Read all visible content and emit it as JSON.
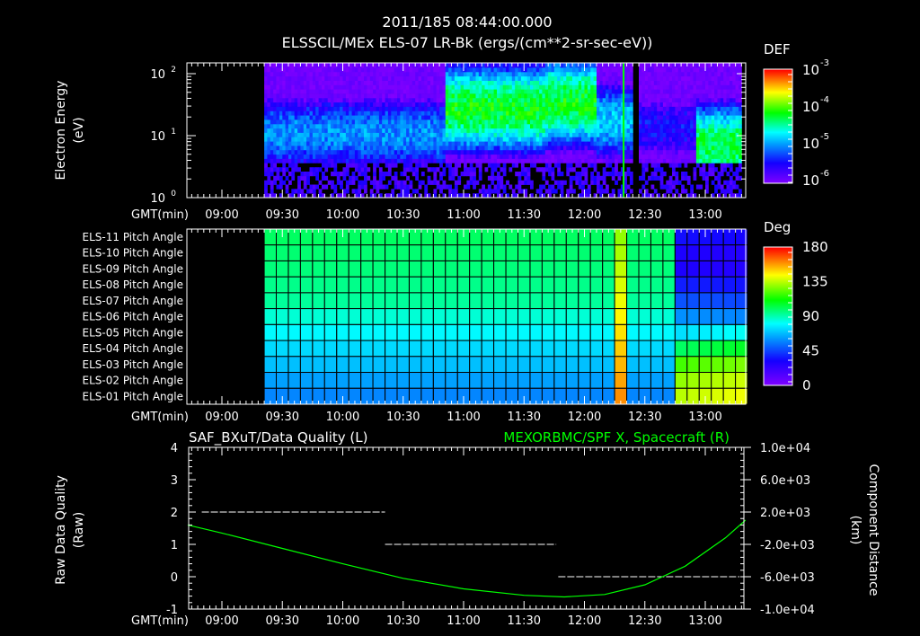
{
  "header": {
    "timestamp": "2011/185 08:44:00.000",
    "title": "ELSSCIL/MEx ELS-07 LR-Bk  (ergs/(cm**2-sr-sec-eV))"
  },
  "colors": {
    "background": "#000000",
    "axis": "#ffffff",
    "orbit_line": "#00ff00",
    "quality_line": "#ffffff"
  },
  "chart_data": [
    {
      "type": "heatmap",
      "name": "energy-spectrogram",
      "ylabel": "Electron Energy\n(eV)",
      "ylabel_lines": [
        "Electron Energy",
        "(eV)"
      ],
      "xlabel": "GMT(min)",
      "yscale": "log",
      "ylim_log10": [
        0,
        2.17
      ],
      "yticks": [
        {
          "exp": 0,
          "label": "10",
          "sup": "0"
        },
        {
          "exp": 1,
          "label": "10",
          "sup": "1"
        },
        {
          "exp": 2,
          "label": "10",
          "sup": "2"
        }
      ],
      "xlim_min": [
        522.6,
        800
      ],
      "xticks": [
        "09:00",
        "09:30",
        "10:00",
        "10:30",
        "11:00",
        "11:30",
        "12:00",
        "12:30",
        "13:00"
      ],
      "colorbar": {
        "label": "DEF",
        "scale": "log",
        "range_log10": [
          -6.3,
          -3
        ],
        "ticks": [
          {
            "base": "10",
            "sup": "-3"
          },
          {
            "base": "10",
            "sup": "-4"
          },
          {
            "base": "10",
            "sup": "-5"
          },
          {
            "base": "10",
            "sup": "-6"
          }
        ]
      },
      "segments": [
        {
          "start": "09:21",
          "end": "10:50",
          "peak_energy_log10": 1.0,
          "peak_def_log10": -5.2
        },
        {
          "start": "10:50",
          "end": "11:40",
          "peak_energy_log10": 1.4,
          "peak_def_log10": -4.3
        },
        {
          "start": "11:40",
          "end": "12:05",
          "peak_energy_log10": 1.5,
          "peak_def_log10": -4.3
        },
        {
          "start": "12:05",
          "end": "12:25",
          "peak_energy_log10": 1.2,
          "peak_def_log10": -5.0
        },
        {
          "start": "12:25",
          "end": "12:55",
          "peak_energy_log10": 1.1,
          "peak_def_log10": -5.7
        },
        {
          "start": "12:55",
          "end": "13:18",
          "peak_energy_log10": 0.8,
          "peak_def_log10": -4.4
        }
      ],
      "data_gaps": [
        {
          "start": "12:24",
          "end": "12:27"
        }
      ]
    },
    {
      "type": "heatmap",
      "name": "pitch-angle",
      "xlabel": "GMT(min)",
      "rows": [
        "ELS-11 Pitch Angle",
        "ELS-10 Pitch Angle",
        "ELS-09 Pitch Angle",
        "ELS-08 Pitch Angle",
        "ELS-07 Pitch Angle",
        "ELS-06 Pitch Angle",
        "ELS-05 Pitch Angle",
        "ELS-04 Pitch Angle",
        "ELS-03 Pitch Angle",
        "ELS-02 Pitch Angle",
        "ELS-01 Pitch Angle"
      ],
      "xticks": [
        "09:00",
        "09:30",
        "10:00",
        "10:30",
        "11:00",
        "11:30",
        "12:00",
        "12:30",
        "13:00"
      ],
      "colorbar": {
        "label": "Deg",
        "range": [
          0,
          180
        ],
        "ticks": [
          "180",
          "135",
          "90",
          "45",
          "0"
        ]
      },
      "periods": [
        {
          "start": "09:21",
          "end": "12:45",
          "values_deg": [
            100,
            98,
            97,
            95,
            93,
            86,
            80,
            74,
            69,
            63,
            58
          ]
        },
        {
          "start": "12:45",
          "end": "13:18",
          "values_deg": [
            35,
            30,
            30,
            38,
            48,
            60,
            75,
            100,
            120,
            130,
            135
          ]
        }
      ],
      "data_gaps": [
        {
          "start": "12:17",
          "end": "12:18"
        },
        {
          "start": "12:24",
          "end": "12:27"
        }
      ]
    },
    {
      "type": "line",
      "name": "quality-and-orbit",
      "title_left": "SAF_BXuT/Data Quality (L)",
      "title_right": "MEXORBMC/SPF X, Spacecraft (R)",
      "ylabel_left": [
        "Raw Data Quality",
        "(Raw)"
      ],
      "ylabel_right": [
        "Component Distance",
        "(km)"
      ],
      "xlabel": "GMT(min)",
      "ylim_left": [
        -1,
        4
      ],
      "yticks_left": [
        "4",
        "3",
        "2",
        "1",
        "0",
        "-1"
      ],
      "ylim_right": [
        -10000,
        10000
      ],
      "yticks_right": [
        "1.0e+04",
        "6.0e+03",
        "2.0e+03",
        "-2.0e+03",
        "-6.0e+03",
        "-1.0e+04"
      ],
      "xticks": [
        "09:00",
        "09:30",
        "10:00",
        "10:30",
        "11:00",
        "11:30",
        "12:00",
        "12:30",
        "13:00"
      ],
      "series": [
        {
          "name": "Data Quality",
          "axis": "left",
          "steps": [
            {
              "start": "08:50",
              "end": "10:21",
              "value": 2
            },
            {
              "start": "10:21",
              "end": "11:46",
              "value": 1
            },
            {
              "start": "11:47",
              "end": "13:17",
              "value": 0
            }
          ]
        },
        {
          "name": "SPF X",
          "axis": "right",
          "x": [
            "08:43",
            "09:00",
            "09:30",
            "10:00",
            "10:30",
            "11:00",
            "11:30",
            "11:50",
            "12:10",
            "12:30",
            "12:50",
            "13:10",
            "13:20"
          ],
          "y": [
            400,
            -600,
            -2500,
            -4400,
            -6200,
            -7500,
            -8300,
            -8500,
            -8200,
            -7000,
            -4700,
            -1200,
            1000
          ]
        }
      ]
    }
  ]
}
